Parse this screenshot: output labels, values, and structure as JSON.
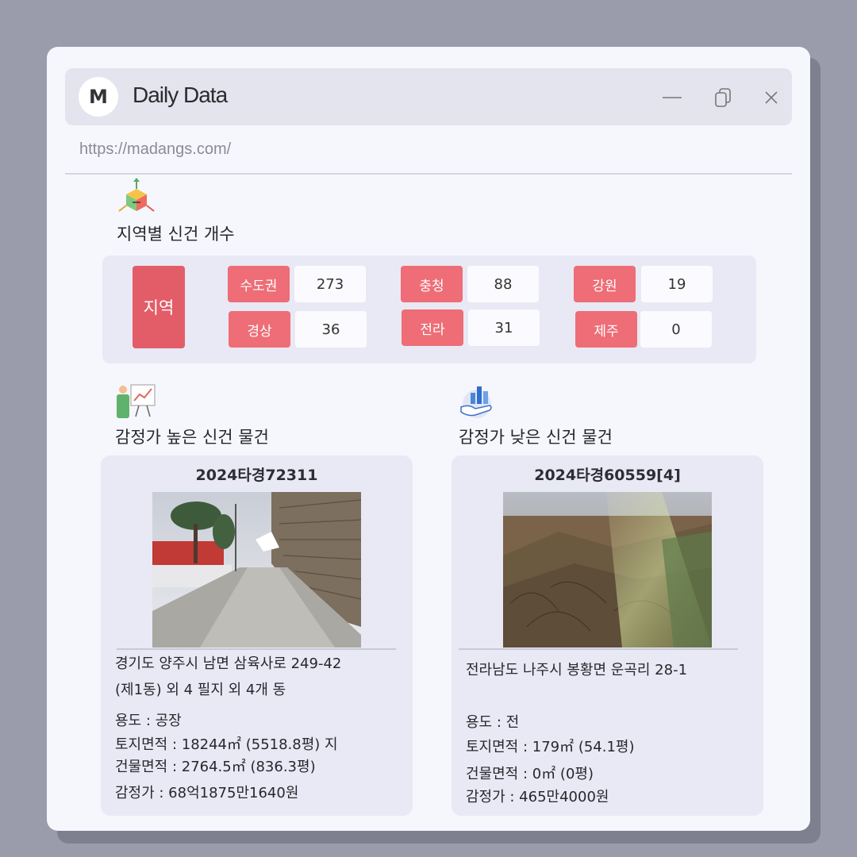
{
  "window": {
    "logo_letter": "M",
    "title": "Daily Data",
    "url": "https://madangs.com/"
  },
  "region_section": {
    "title": "지역별 신건 개수",
    "head_label": "지역",
    "regions": [
      {
        "name": "수도권",
        "count": "273"
      },
      {
        "name": "충청",
        "count": "88"
      },
      {
        "name": "강원",
        "count": "19"
      },
      {
        "name": "경상",
        "count": "36"
      },
      {
        "name": "전라",
        "count": "31"
      },
      {
        "name": "제주",
        "count": "0"
      }
    ]
  },
  "high_section": {
    "title": "감정가 높은 신건 물건",
    "case_no": "2024타경72311",
    "address_line1": "경기도 양주시 남면 삼육사로 249-42",
    "address_line2": "(제1동) 외 4 필지 외 4개 동",
    "usage": "용도 : 공장",
    "land_area": "토지면적 : 18244㎡ (5518.8평) 지",
    "building_area": "건물면적 : 2764.5㎡ (836.3평)",
    "appraisal": "감정가 : 68억1875만1640원"
  },
  "low_section": {
    "title": "감정가 낮은 신건 물건",
    "case_no": "2024타경60559[4]",
    "address_line1": "전라남도 나주시 봉황면 운곡리 28-1",
    "usage": "용도 : 전",
    "land_area": "토지면적 : 179㎡ (54.1평)",
    "building_area": "건물면적 : 0㎡ (0평)",
    "appraisal": "감정가 : 465만4000원"
  },
  "colors": {
    "region_head": "#e35d68",
    "region_label": "#ee6d76",
    "card_bg": "#e8e9f4"
  }
}
